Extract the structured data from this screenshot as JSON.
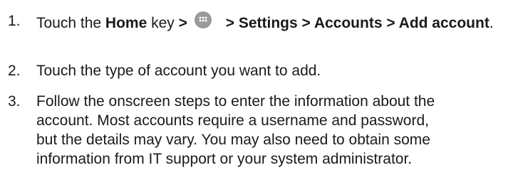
{
  "steps": [
    {
      "number": "1.",
      "prefix": "Touch the ",
      "home": "Home",
      "key": " key ",
      "sep1": ">",
      "icon": "apps-drawer-icon",
      "path": " > Settings > Accounts > Add account",
      "end": "."
    },
    {
      "number": "2.",
      "text": "Touch the type of account you want to add."
    },
    {
      "number": "3.",
      "line1": "Follow the onscreen steps to enter the information about the",
      "line2": "account. Most accounts require a username and password,",
      "line3": "but the details may vary. You may also need to obtain some",
      "line4": "information from IT support or your system administrator."
    }
  ],
  "colors": {
    "text": "#1a1a1a",
    "icon_bg": "#9a9a9a",
    "icon_dots": "#ffffff"
  }
}
